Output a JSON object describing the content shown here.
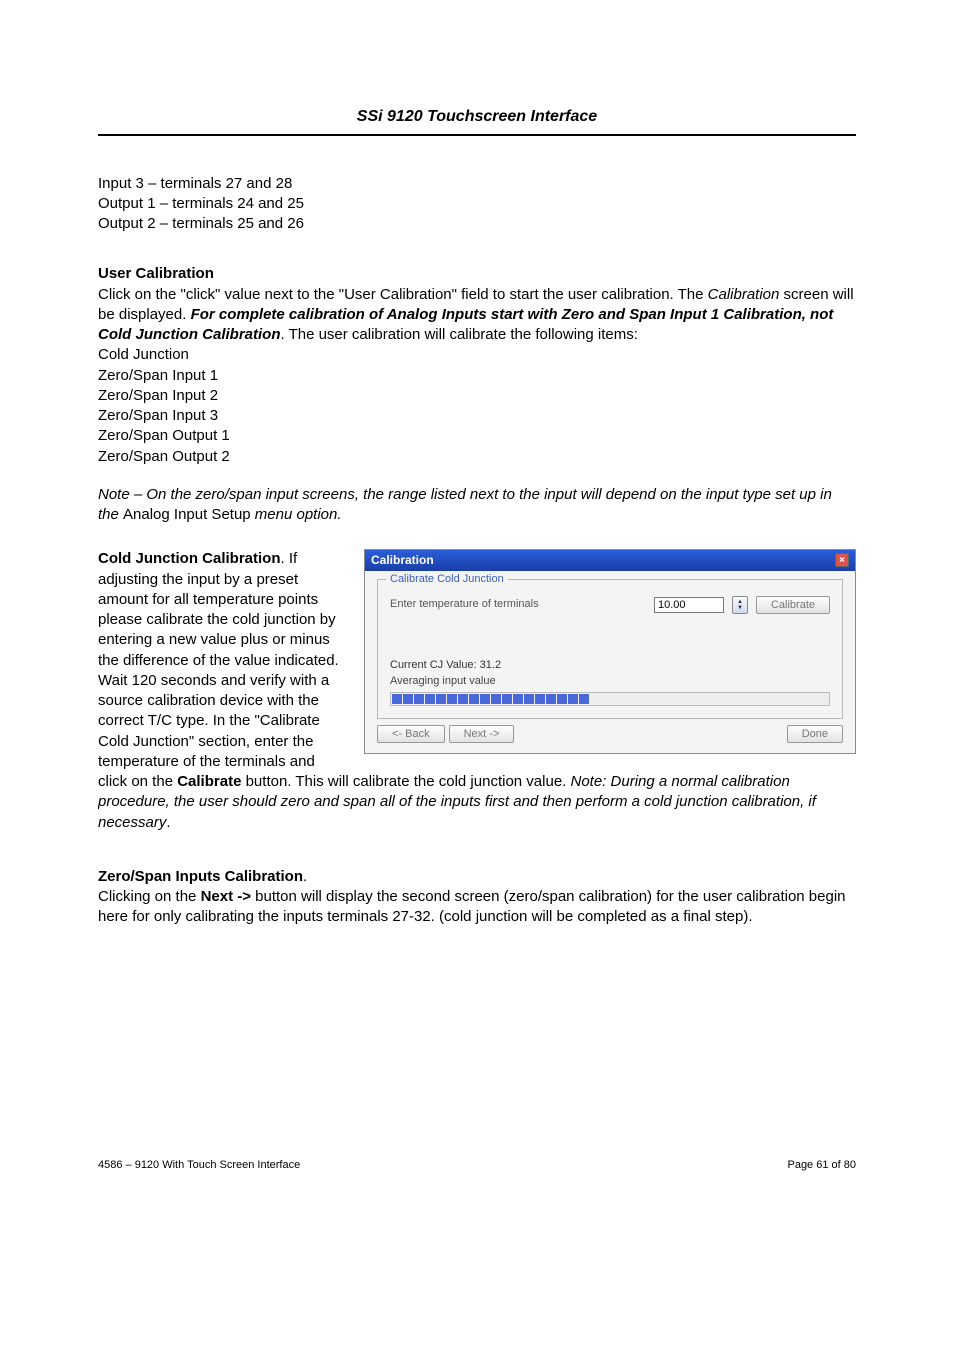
{
  "header": {
    "title": "SSi 9120 Touchscreen Interface"
  },
  "intro": {
    "line1": "Input 3 – terminals 27 and 28",
    "line2": "Output 1 – terminals 24 and 25",
    "line3": "Output 2 – terminals 25 and 26"
  },
  "user_calibration": {
    "heading": "User Calibration",
    "p1a": "Click on the \"click\" value next to the \"User Calibration\" field to start the user calibration.  The ",
    "p1b": "Calibration",
    "p1c": " screen will be displayed. ",
    "p1d": "For complete calibration of Analog Inputs start with Zero and Span Input 1 Calibration, not Cold Junction Calibration",
    "p1e": ".   The user calibration will calibrate the following items:",
    "items": {
      "a": "Cold Junction",
      "b": "Zero/Span Input 1",
      "c": "Zero/Span Input 2",
      "d": "Zero/Span Input 3",
      "e": "Zero/Span Output 1",
      "f": "Zero/Span Output 2"
    }
  },
  "note1": {
    "a": "Note – On the zero/span input screens, the range listed next to the input will depend on the input type set up in the ",
    "b": "Analog Input Setup",
    "c": " menu option"
  },
  "cold_junction": {
    "heading": "Cold Junction Calibration",
    "wrap_text": "If adjusting the input by a preset amount for all temperature points please calibrate the cold junction by entering a new value plus or minus the difference of the value indicated.  Wait 120 seconds and verify with a source calibration device with ",
    "after1": "the correct T/C type.  In the \"Calibrate Cold Junction\" section, enter the temperature of the terminals and click on the ",
    "calibrate_word": "Calibrate",
    "after2": " button.  This will calibrate the cold junction value.  ",
    "note_label": "Note: ",
    "note_body": "During a normal calibration procedure, the user should zero and span all of the inputs first and then perform a cold junction calibration, if necessary",
    "period": "."
  },
  "zero_span": {
    "heading": "Zero/Span Inputs Calibration",
    "a": "Clicking on the ",
    "b": "Next ->",
    "c": " button will display the second screen (zero/span calibration) for the user calibration begin here for only calibrating the inputs terminals 27-32. (cold junction will be completed as a final step)."
  },
  "dialog": {
    "title": "Calibration",
    "legend": "Calibrate Cold Junction",
    "field_label": "Enter temperature of terminals",
    "field_value": "10.00",
    "calibrate_btn": "Calibrate",
    "current_cj": "Current CJ Value: 31.2",
    "averaging": "Averaging input value",
    "back_btn": "<- Back",
    "next_btn": "Next ->",
    "done_btn": "Done"
  },
  "footer": {
    "left": "4586 – 9120 With Touch Screen Interface",
    "right": "Page 61 of 80"
  }
}
